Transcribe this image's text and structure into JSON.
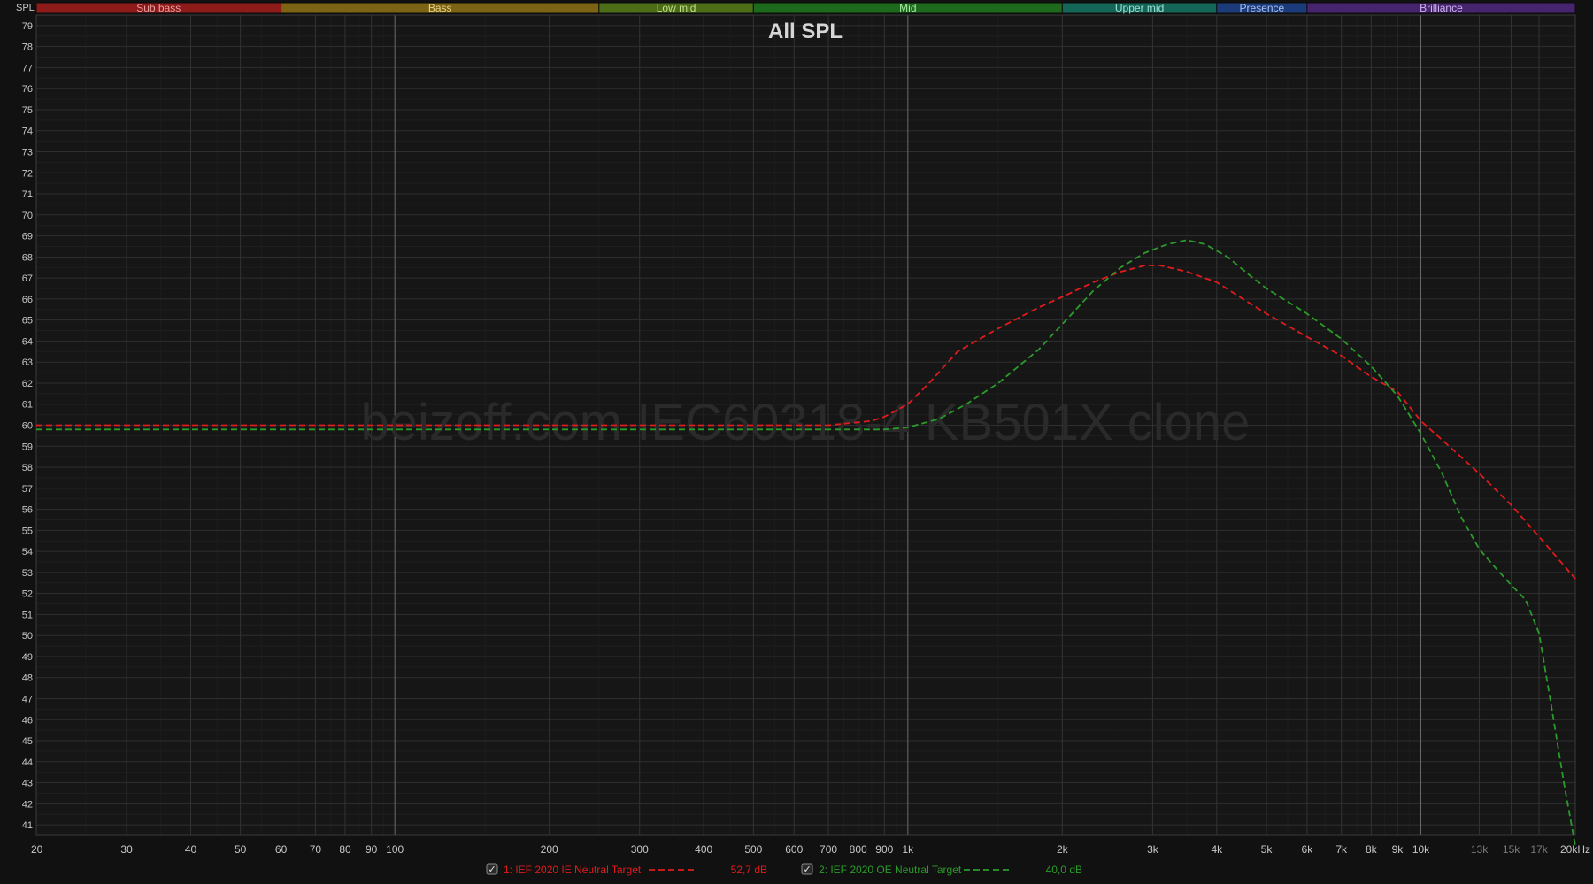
{
  "chart_data": {
    "type": "line",
    "title": "All SPL",
    "ylabel": "SPL",
    "watermark": "beizoff.com IEC60318-4 KB501X clone",
    "xscale": "log",
    "xlim": [
      20,
      20000
    ],
    "ylim": [
      40.5,
      79.5
    ],
    "grid": true,
    "y_ticks": [
      41,
      42,
      43,
      44,
      45,
      46,
      47,
      48,
      49,
      50,
      51,
      52,
      53,
      54,
      55,
      56,
      57,
      58,
      59,
      60,
      61,
      62,
      63,
      64,
      65,
      66,
      67,
      68,
      69,
      70,
      71,
      72,
      73,
      74,
      75,
      76,
      77,
      78,
      79
    ],
    "x_ticks": [
      {
        "value": 20,
        "label": "20"
      },
      {
        "value": 30,
        "label": "30"
      },
      {
        "value": 40,
        "label": "40"
      },
      {
        "value": 50,
        "label": "50"
      },
      {
        "value": 60,
        "label": "60"
      },
      {
        "value": 70,
        "label": "70"
      },
      {
        "value": 80,
        "label": "80"
      },
      {
        "value": 90,
        "label": "90"
      },
      {
        "value": 100,
        "label": "100"
      },
      {
        "value": 200,
        "label": "200"
      },
      {
        "value": 300,
        "label": "300"
      },
      {
        "value": 400,
        "label": "400"
      },
      {
        "value": 500,
        "label": "500"
      },
      {
        "value": 600,
        "label": "600"
      },
      {
        "value": 700,
        "label": "700"
      },
      {
        "value": 800,
        "label": "800"
      },
      {
        "value": 900,
        "label": "900"
      },
      {
        "value": 1000,
        "label": "1k"
      },
      {
        "value": 2000,
        "label": "2k"
      },
      {
        "value": 3000,
        "label": "3k"
      },
      {
        "value": 4000,
        "label": "4k"
      },
      {
        "value": 5000,
        "label": "5k"
      },
      {
        "value": 6000,
        "label": "6k"
      },
      {
        "value": 7000,
        "label": "7k"
      },
      {
        "value": 8000,
        "label": "8k"
      },
      {
        "value": 9000,
        "label": "9k"
      },
      {
        "value": 10000,
        "label": "10k"
      },
      {
        "value": 13000,
        "label": "13k",
        "dim": true
      },
      {
        "value": 15000,
        "label": "15k",
        "dim": true
      },
      {
        "value": 17000,
        "label": "17k",
        "dim": true
      },
      {
        "value": 20000,
        "label": "20kHz"
      }
    ],
    "bands": [
      {
        "name": "Sub bass",
        "from": 20,
        "to": 60,
        "color": "#8e1a1a",
        "text_color": "#e8a0a0"
      },
      {
        "name": "Bass",
        "from": 60,
        "to": 250,
        "color": "#7d6414",
        "text_color": "#e6d48a"
      },
      {
        "name": "Low mid",
        "from": 250,
        "to": 500,
        "color": "#4c6e16",
        "text_color": "#bfe08a"
      },
      {
        "name": "Mid",
        "from": 500,
        "to": 2000,
        "color": "#1d6a1d",
        "text_color": "#a8e8a8"
      },
      {
        "name": "Upper mid",
        "from": 2000,
        "to": 4000,
        "color": "#136658",
        "text_color": "#9fe0d2"
      },
      {
        "name": "Presence",
        "from": 4000,
        "to": 6000,
        "color": "#1b3b7a",
        "text_color": "#a9c0f0"
      },
      {
        "name": "Brilliance",
        "from": 6000,
        "to": 20000,
        "color": "#46246e",
        "text_color": "#cfb3ee"
      }
    ],
    "series": [
      {
        "name": "1: IEF 2020 IE Neutral Target",
        "legend_value": "52,7 dB",
        "color": "#e01b1b",
        "checked": true,
        "dash": true,
        "points": [
          [
            20,
            60.0
          ],
          [
            50,
            60.0
          ],
          [
            100,
            60.0
          ],
          [
            200,
            60.0
          ],
          [
            400,
            60.0
          ],
          [
            700,
            60.0
          ],
          [
            850,
            60.2
          ],
          [
            900,
            60.4
          ],
          [
            1000,
            61.0
          ],
          [
            1100,
            62.0
          ],
          [
            1250,
            63.5
          ],
          [
            1500,
            64.6
          ],
          [
            1800,
            65.6
          ],
          [
            2000,
            66.1
          ],
          [
            2300,
            66.8
          ],
          [
            2600,
            67.3
          ],
          [
            2900,
            67.6
          ],
          [
            3100,
            67.6
          ],
          [
            3500,
            67.3
          ],
          [
            4000,
            66.8
          ],
          [
            4500,
            66.0
          ],
          [
            5000,
            65.3
          ],
          [
            6000,
            64.2
          ],
          [
            7000,
            63.3
          ],
          [
            8000,
            62.3
          ],
          [
            9000,
            61.6
          ],
          [
            10000,
            60.2
          ],
          [
            11000,
            59.3
          ],
          [
            13000,
            57.7
          ],
          [
            15000,
            56.2
          ],
          [
            17000,
            54.7
          ],
          [
            20000,
            52.7
          ]
        ]
      },
      {
        "name": "2: IEF 2020 OE Neutral Target",
        "legend_value": "40,0 dB",
        "color": "#2a9b2a",
        "checked": true,
        "dash": true,
        "points": [
          [
            20,
            59.8
          ],
          [
            50,
            59.8
          ],
          [
            100,
            59.8
          ],
          [
            200,
            59.8
          ],
          [
            400,
            59.8
          ],
          [
            700,
            59.8
          ],
          [
            900,
            59.8
          ],
          [
            1000,
            59.9
          ],
          [
            1150,
            60.3
          ],
          [
            1300,
            61.0
          ],
          [
            1500,
            62.0
          ],
          [
            1800,
            63.6
          ],
          [
            2000,
            64.8
          ],
          [
            2300,
            66.4
          ],
          [
            2600,
            67.5
          ],
          [
            2900,
            68.2
          ],
          [
            3200,
            68.6
          ],
          [
            3500,
            68.8
          ],
          [
            3800,
            68.6
          ],
          [
            4200,
            68.0
          ],
          [
            4600,
            67.2
          ],
          [
            5000,
            66.5
          ],
          [
            6000,
            65.3
          ],
          [
            7000,
            64.1
          ],
          [
            8000,
            62.8
          ],
          [
            9000,
            61.4
          ],
          [
            10000,
            59.6
          ],
          [
            11000,
            57.7
          ],
          [
            12000,
            55.6
          ],
          [
            13000,
            54.1
          ],
          [
            14000,
            53.2
          ],
          [
            15000,
            52.4
          ],
          [
            16000,
            51.7
          ],
          [
            17000,
            50.1
          ],
          [
            18000,
            46.5
          ],
          [
            19000,
            43.0
          ],
          [
            20000,
            40.0
          ]
        ]
      }
    ]
  }
}
